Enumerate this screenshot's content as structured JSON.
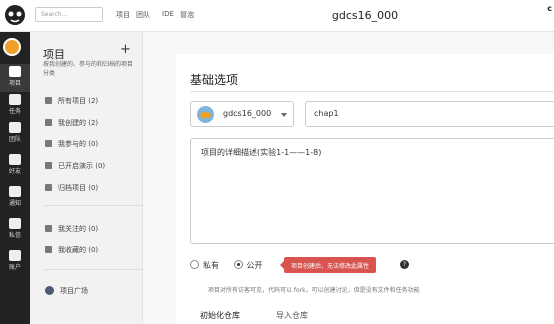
{
  "topbar": {
    "search_placeholder": "Search...",
    "nav": [
      "项目",
      "团队",
      "IDE",
      "冒泡"
    ],
    "title": "gdcs16_000",
    "corner_text": "c"
  },
  "rail": {
    "items": [
      {
        "label": "项目",
        "icon": "project-icon"
      },
      {
        "label": "任务",
        "icon": "task-icon"
      },
      {
        "label": "团队",
        "icon": "team-icon"
      },
      {
        "label": "好友",
        "icon": "friend-icon"
      },
      {
        "label": "通知",
        "icon": "bell-icon"
      },
      {
        "label": "私信",
        "icon": "mail-icon"
      },
      {
        "label": "账户",
        "icon": "account-icon"
      }
    ]
  },
  "sidebar": {
    "heading": "项目",
    "add": "+",
    "description": "按我创建的、参与的和归档的项目分类",
    "items": [
      {
        "label": "所有项目 (2)",
        "icon": "folder-icon"
      },
      {
        "label": "我创建的 (2)",
        "icon": "edit-icon"
      },
      {
        "label": "我参与的 (0)",
        "icon": "hand-icon"
      },
      {
        "label": "已开启演示 (0)",
        "icon": "play-icon"
      },
      {
        "label": "归档项目 (0)",
        "icon": "archive-icon"
      },
      {
        "label": "我关注的 (0)",
        "icon": "eye-icon"
      },
      {
        "label": "我收藏的 (0)",
        "icon": "star-icon"
      }
    ],
    "plaza": "项目广场"
  },
  "form": {
    "section_title": "基础选项",
    "owner": "gdcs16_000",
    "project_name": "chap1",
    "description": "项目的详细描述(实验1-1——1-8)",
    "visibility_private": "私有",
    "visibility_public": "公开",
    "visibility_selected": "public",
    "tip": "项目创建后，无法修改此属性",
    "help": "?",
    "hint": "项目对所有访客可见，代码可以 fork，可以创建讨论，但是没有文件和任务功能",
    "tabs": [
      "初始化仓库",
      "导入仓库"
    ],
    "active_tab": 0
  },
  "colors": {
    "rail_bg": "#222222",
    "tip_bg": "#d9534f",
    "avatar": "#f0a028"
  }
}
